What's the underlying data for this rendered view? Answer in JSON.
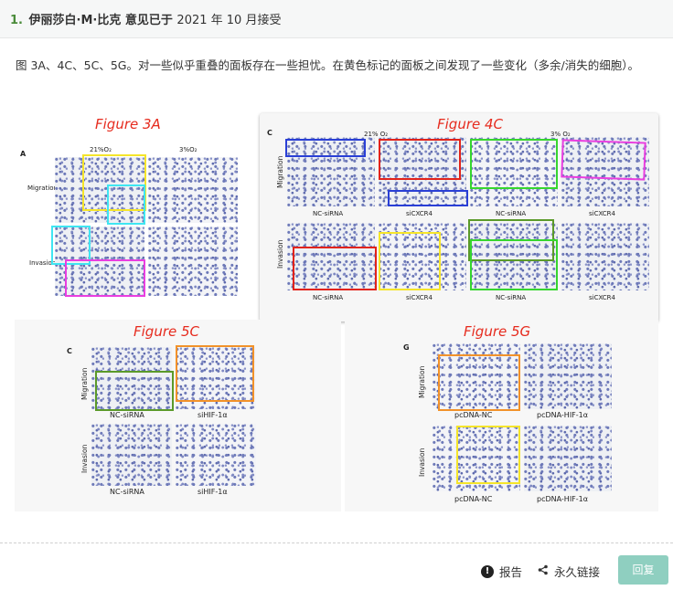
{
  "header": {
    "number": "1.",
    "author": "伊丽莎白·M·比克",
    "action": "意见已于",
    "date_text": "2021 年 10 月接受"
  },
  "intro": {
    "text": "图 3A、4C、5C、5G。对一些似乎重叠的面板存在一些担忧。在黄色标记的面板之间发现了一些变化（多余/消失的细胞）。"
  },
  "figure": {
    "fig3a": {
      "title": "Figure 3A",
      "panel_letter": "A",
      "col1": "21%O₂",
      "col2": "3%O₂",
      "row1": "Migration",
      "row2": "Invasion"
    },
    "fig4c": {
      "title": "Figure 4C",
      "panel_letter": "C",
      "col1": "21% O₂",
      "col2": "3% O₂",
      "row1": "Migration",
      "row2": "Invasion",
      "labels": [
        "NC-siRNA",
        "siCXCR4",
        "NC-siRNA",
        "siCXCR4"
      ]
    },
    "fig5c": {
      "title": "Figure 5C",
      "panel_letter": "C",
      "row1": "Migration",
      "row2": "Invasion",
      "labels": [
        "NC-siRNA",
        "siHIF-1α"
      ]
    },
    "fig5g": {
      "title": "Figure 5G",
      "panel_letter": "G",
      "row1": "Migration",
      "row2": "Invasion",
      "labels": [
        "pcDNA-NC",
        "pcDNA-HIF-1α"
      ]
    },
    "colors": {
      "yellow": "#f5e52a",
      "cyan": "#3fe6f2",
      "magenta": "#e93ee0",
      "blue": "#2a3fd6",
      "red": "#e2231a",
      "green": "#36d62f",
      "olive": "#5b9a2a",
      "orange": "#f2922a"
    }
  },
  "footer": {
    "report_label": "报告",
    "report_icon": "exclamation-circle-icon",
    "permalink_label": "永久链接",
    "permalink_icon": "share-icon",
    "reply_label": "回复"
  }
}
